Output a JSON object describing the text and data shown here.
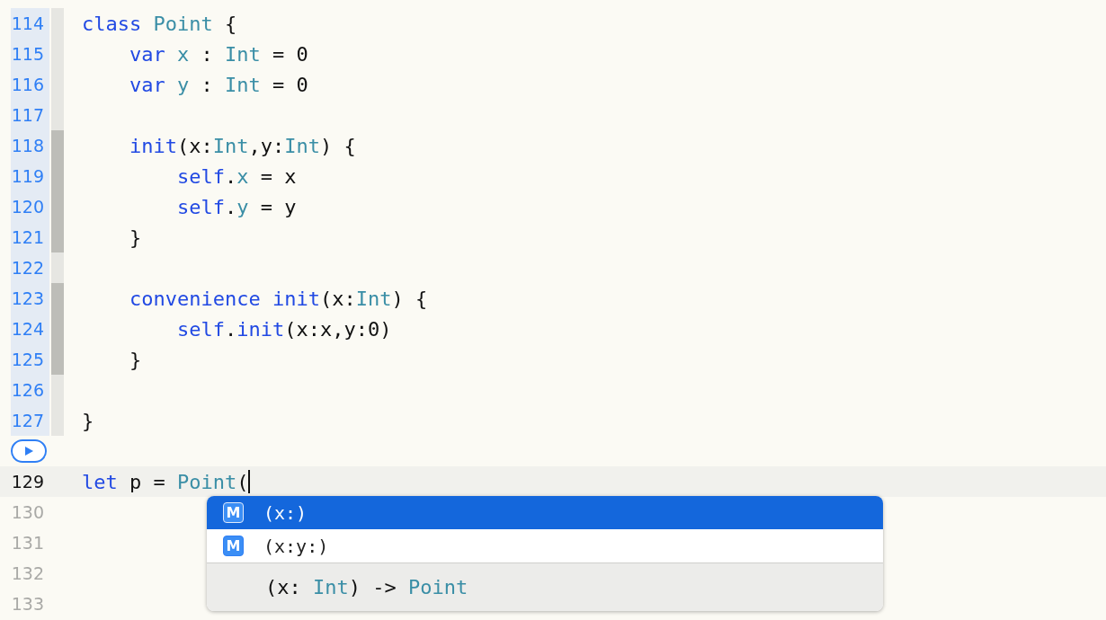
{
  "lines": [
    {
      "kind": "code",
      "number": "114",
      "executed": true,
      "current": false,
      "inner_scope": false,
      "tokens": [
        {
          "text": "class",
          "color": "#2149e3"
        },
        {
          "text": " Point",
          "color": "#3a8ea6"
        },
        {
          "text": " {",
          "color": "#111111"
        }
      ]
    },
    {
      "kind": "code",
      "number": "115",
      "executed": true,
      "current": false,
      "inner_scope": false,
      "tokens": [
        {
          "text": "    var",
          "color": "#2149e3"
        },
        {
          "text": " x",
          "color": "#3a8ea6"
        },
        {
          "text": " :",
          "color": "#111111"
        },
        {
          "text": " Int",
          "color": "#3a8ea6"
        },
        {
          "text": " = 0",
          "color": "#111111"
        }
      ]
    },
    {
      "kind": "code",
      "number": "116",
      "executed": true,
      "current": false,
      "inner_scope": false,
      "tokens": [
        {
          "text": "    var",
          "color": "#2149e3"
        },
        {
          "text": " y",
          "color": "#3a8ea6"
        },
        {
          "text": " :",
          "color": "#111111"
        },
        {
          "text": " Int",
          "color": "#3a8ea6"
        },
        {
          "text": " = 0",
          "color": "#111111"
        }
      ]
    },
    {
      "kind": "code",
      "number": "117",
      "executed": true,
      "current": false,
      "inner_scope": false
    },
    {
      "kind": "code",
      "number": "118",
      "executed": true,
      "current": false,
      "inner_scope": true,
      "tokens": [
        {
          "text": "    init",
          "color": "#2149e3"
        },
        {
          "text": "(x:",
          "color": "#111111"
        },
        {
          "text": "Int",
          "color": "#3a8ea6"
        },
        {
          "text": ",y:",
          "color": "#111111"
        },
        {
          "text": "Int",
          "color": "#3a8ea6"
        },
        {
          "text": ") {",
          "color": "#111111"
        }
      ]
    },
    {
      "kind": "code",
      "number": "119",
      "executed": true,
      "current": false,
      "inner_scope": true,
      "tokens": [
        {
          "text": "        self",
          "color": "#2149e3"
        },
        {
          "text": ".",
          "color": "#111111"
        },
        {
          "text": "x",
          "color": "#3a8ea6"
        },
        {
          "text": " = x",
          "color": "#111111"
        }
      ]
    },
    {
      "kind": "code",
      "number": "120",
      "executed": true,
      "current": false,
      "inner_scope": true,
      "tokens": [
        {
          "text": "        self",
          "color": "#2149e3"
        },
        {
          "text": ".",
          "color": "#111111"
        },
        {
          "text": "y",
          "color": "#3a8ea6"
        },
        {
          "text": " = y",
          "color": "#111111"
        }
      ]
    },
    {
      "kind": "code",
      "number": "121",
      "executed": true,
      "current": false,
      "inner_scope": true,
      "tokens": [
        {
          "text": "    }",
          "color": "#111111"
        }
      ]
    },
    {
      "kind": "code",
      "number": "122",
      "executed": true,
      "current": false,
      "inner_scope": false
    },
    {
      "kind": "code",
      "number": "123",
      "executed": true,
      "current": false,
      "inner_scope": true,
      "tokens": [
        {
          "text": "    convenience",
          "color": "#2149e3"
        },
        {
          "text": " init",
          "color": "#2149e3"
        },
        {
          "text": "(x:",
          "color": "#111111"
        },
        {
          "text": "Int",
          "color": "#3a8ea6"
        },
        {
          "text": ") {",
          "color": "#111111"
        }
      ]
    },
    {
      "kind": "code",
      "number": "124",
      "executed": true,
      "current": false,
      "inner_scope": true,
      "tokens": [
        {
          "text": "        self",
          "color": "#2149e3"
        },
        {
          "text": ".",
          "color": "#111111"
        },
        {
          "text": "init",
          "color": "#2149e3"
        },
        {
          "text": "(x:x,y:0)",
          "color": "#111111"
        }
      ]
    },
    {
      "kind": "code",
      "number": "125",
      "executed": true,
      "current": false,
      "inner_scope": true,
      "tokens": [
        {
          "text": "    }",
          "color": "#111111"
        }
      ]
    },
    {
      "kind": "code",
      "number": "126",
      "executed": true,
      "current": false,
      "inner_scope": false
    },
    {
      "kind": "code",
      "number": "127",
      "executed": true,
      "current": false,
      "inner_scope": false,
      "tokens": [
        {
          "text": "}",
          "color": "#111111"
        }
      ]
    },
    {
      "kind": "run_marker"
    },
    {
      "kind": "code",
      "number": "129",
      "executed": false,
      "current": true,
      "tokens": [
        {
          "text": "let",
          "color": "#2149e3"
        },
        {
          "text": " p =",
          "color": "#111111"
        },
        {
          "text": " Point",
          "color": "#3a8ea6"
        },
        {
          "text": "(",
          "color": "#111111"
        }
      ]
    },
    {
      "kind": "code",
      "number": "130",
      "executed": false,
      "current": false
    },
    {
      "kind": "code",
      "number": "131",
      "executed": false,
      "current": false
    },
    {
      "kind": "code",
      "number": "132",
      "executed": false,
      "current": false
    },
    {
      "kind": "code",
      "number": "133",
      "executed": false,
      "current": false
    }
  ],
  "completion": {
    "items": [
      {
        "badge": "M",
        "label": "(x:)",
        "selected": true
      },
      {
        "badge": "M",
        "label": "(x:y:)",
        "selected": false
      }
    ],
    "detail": [
      {
        "text": "(x:",
        "color": "#111111"
      },
      {
        "text": " Int",
        "color": "#3a8ea6"
      },
      {
        "text": ") ->",
        "color": "#111111"
      },
      {
        "text": " Point",
        "color": "#3a8ea6"
      }
    ]
  }
}
